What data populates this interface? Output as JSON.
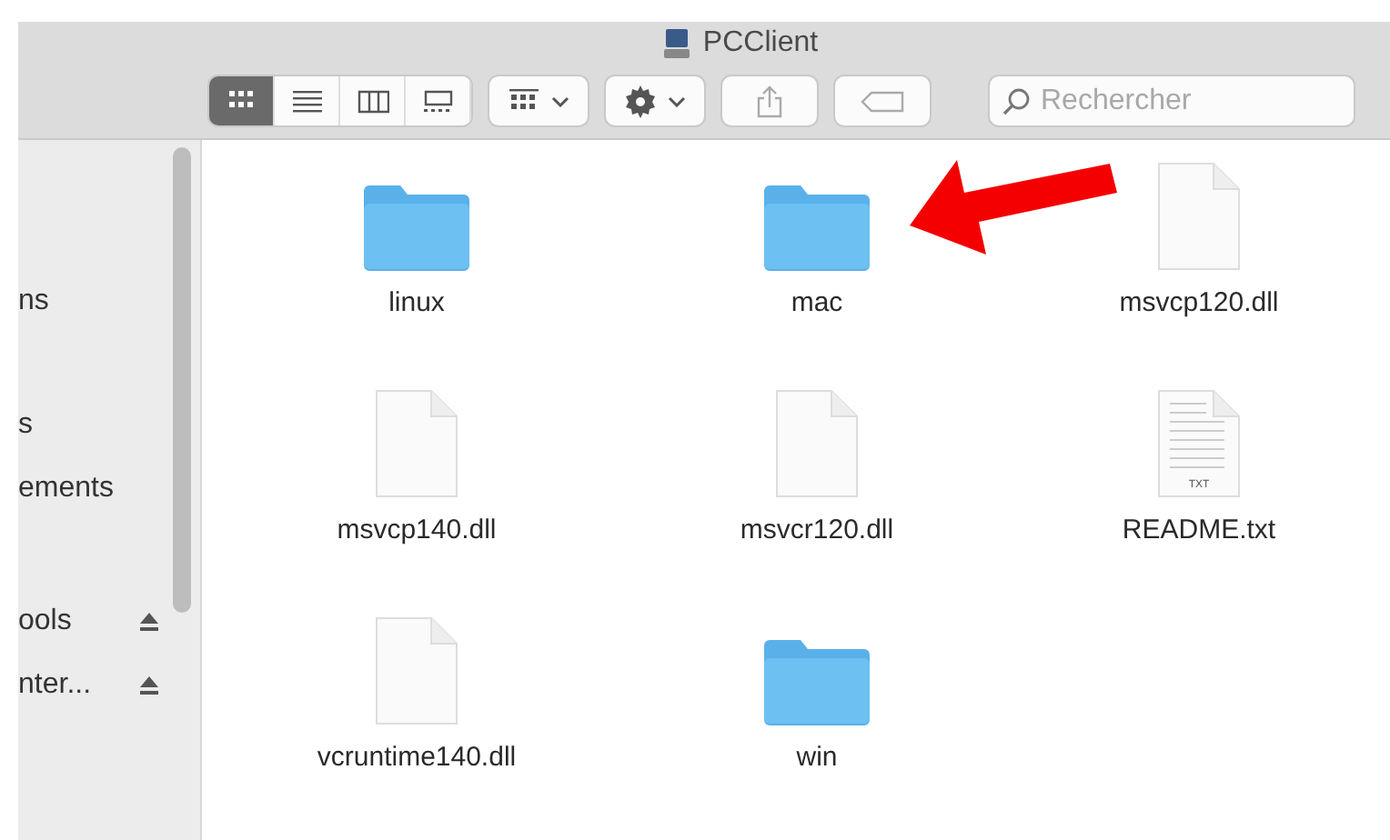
{
  "window": {
    "title": "PCClient"
  },
  "toolbar": {
    "view_modes": [
      {
        "selected": true
      },
      {
        "selected": false
      },
      {
        "selected": false
      },
      {
        "selected": false
      }
    ],
    "search": {
      "placeholder": "Rechercher"
    }
  },
  "sidebar": {
    "items": [
      {
        "label": "ns",
        "eject": false
      },
      {
        "label": "s",
        "eject": false
      },
      {
        "label": "ements",
        "eject": false
      },
      {
        "label": "ools",
        "eject": true
      },
      {
        "label": "nter...",
        "eject": true
      }
    ]
  },
  "files": [
    {
      "name": "linux",
      "kind": "folder"
    },
    {
      "name": "mac",
      "kind": "folder"
    },
    {
      "name": "msvcp120.dll",
      "kind": "file"
    },
    {
      "name": "msvcp140.dll",
      "kind": "file"
    },
    {
      "name": "msvcr120.dll",
      "kind": "file"
    },
    {
      "name": "README.txt",
      "kind": "text",
      "badge": "TXT"
    },
    {
      "name": "vcruntime140.dll",
      "kind": "file"
    },
    {
      "name": "win",
      "kind": "folder"
    }
  ]
}
